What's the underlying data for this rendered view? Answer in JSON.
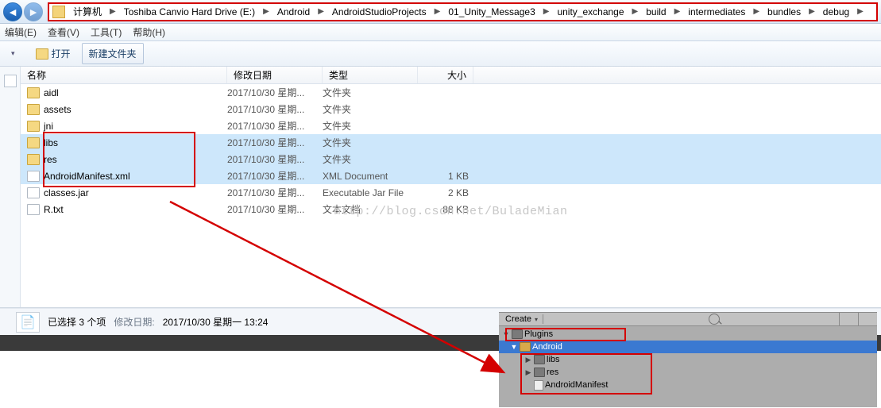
{
  "breadcrumb": {
    "root_label": "计算机",
    "items": [
      "Toshiba Canvio Hard Drive (E:)",
      "Android",
      "AndroidStudioProjects",
      "01_Unity_Message3",
      "unity_exchange",
      "build",
      "intermediates",
      "bundles",
      "debug"
    ]
  },
  "menu": {
    "edit": "编辑(E)",
    "view": "查看(V)",
    "tools": "工具(T)",
    "help": "帮助(H)"
  },
  "toolbar": {
    "open": "打开",
    "newfolder": "新建文件夹"
  },
  "columns": {
    "name": "名称",
    "date": "修改日期",
    "type": "类型",
    "size": "大小"
  },
  "rows": [
    {
      "name": "aidl",
      "date": "2017/10/30 星期...",
      "type": "文件夹",
      "size": "",
      "icon": "folder",
      "sel": false
    },
    {
      "name": "assets",
      "date": "2017/10/30 星期...",
      "type": "文件夹",
      "size": "",
      "icon": "folder",
      "sel": false
    },
    {
      "name": "jni",
      "date": "2017/10/30 星期...",
      "type": "文件夹",
      "size": "",
      "icon": "folder",
      "sel": false
    },
    {
      "name": "libs",
      "date": "2017/10/30 星期...",
      "type": "文件夹",
      "size": "",
      "icon": "folder",
      "sel": true
    },
    {
      "name": "res",
      "date": "2017/10/30 星期...",
      "type": "文件夹",
      "size": "",
      "icon": "folder",
      "sel": true
    },
    {
      "name": "AndroidManifest.xml",
      "date": "2017/10/30 星期...",
      "type": "XML Document",
      "size": "1 KB",
      "icon": "file",
      "sel": true
    },
    {
      "name": "classes.jar",
      "date": "2017/10/30 星期...",
      "type": "Executable Jar File",
      "size": "2 KB",
      "icon": "jar",
      "sel": false
    },
    {
      "name": "R.txt",
      "date": "2017/10/30 星期...",
      "type": "文本文档",
      "size": "88 KB",
      "icon": "txt",
      "sel": false
    }
  ],
  "status": {
    "count": "已选择 3 个项",
    "labelkey": "修改日期:",
    "value": "2017/10/30 星期一 13:24"
  },
  "unity": {
    "create": "Create",
    "tree": {
      "plugins": "Plugins",
      "android": "Android",
      "libs": "libs",
      "res": "res",
      "manifest": "AndroidManifest"
    }
  },
  "watermark": "http://blog.csdn.net/BuladeMian"
}
